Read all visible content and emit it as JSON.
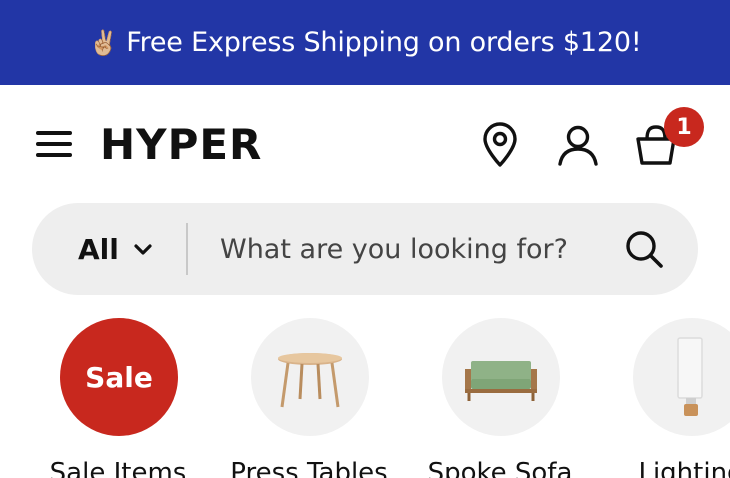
{
  "announcement": {
    "emoji": "✌🏼",
    "text": "Free Express Shipping on orders $120!"
  },
  "header": {
    "logo": "HYPER",
    "cart_count": "1",
    "icons": [
      "menu-icon",
      "location-pin-icon",
      "account-icon",
      "shopping-bag-icon"
    ]
  },
  "search": {
    "scope": "All",
    "placeholder": "What are you looking for?",
    "icons": [
      "chevron-down-icon",
      "search-icon"
    ]
  },
  "categories": [
    {
      "label": "Sale Items",
      "badge": "Sale"
    },
    {
      "label": "Press Tables"
    },
    {
      "label": "Spoke Sofa"
    },
    {
      "label": "Lighting"
    }
  ],
  "colors": {
    "announcement_bg": "#2236a6",
    "sale_red": "#c8281e",
    "search_bg": "#eeeeee"
  }
}
